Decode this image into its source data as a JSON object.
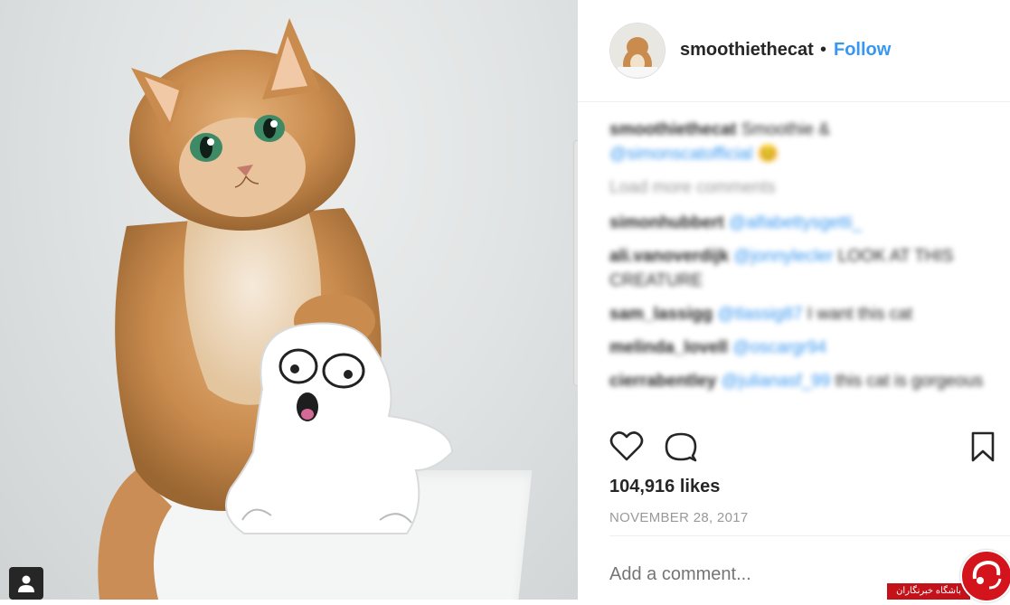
{
  "post": {
    "username": "smoothiethecat",
    "separator": "•",
    "follow_label": "Follow",
    "likes": "104,916 likes",
    "date": "NOVEMBER 28, 2017",
    "comment_placeholder": "Add a comment..."
  },
  "caption": {
    "username": "smoothiethecat",
    "text": "Smoothie &",
    "mention": "@simonscatofficial",
    "emoji": "😊"
  },
  "load_more": "Load more comments",
  "comments": [
    {
      "user": "simonhubbert",
      "mention": "@alfabettysgetti_",
      "text": ""
    },
    {
      "user": "ali.vanoverdijk",
      "mention": "@jonnylecler",
      "text": "LOOK AT THIS CREATURE"
    },
    {
      "user": "sam_lassigg",
      "mention": "@tlassig87",
      "text": "I want this cat"
    },
    {
      "user": "melinda_lovell",
      "mention": "@oscargr94",
      "text": ""
    },
    {
      "user": "cierrabentley",
      "mention": "@julianasf_99",
      "text": "this cat is gorgeous"
    }
  ],
  "icons": [
    "heart-icon",
    "comment-icon",
    "bookmark-icon",
    "user-tag-icon"
  ],
  "watermark": {
    "text": "باشگاه خبرنگاران"
  },
  "colors": {
    "link": "#3897f0",
    "text": "#262626",
    "muted": "#999999",
    "watermark": "#c4121a"
  }
}
